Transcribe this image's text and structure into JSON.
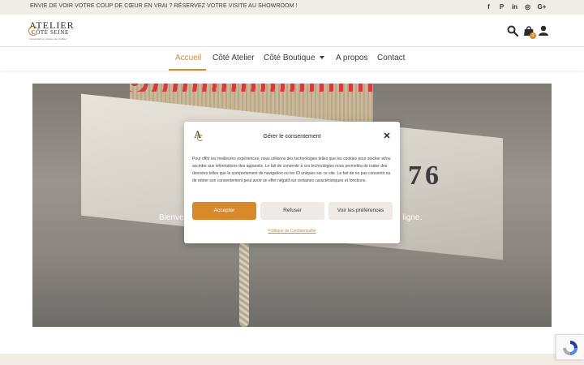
{
  "topbar": {
    "message": "ENVIE DE VOIR VOTRE COUP DE CŒUR EN VRAI ? RÉSERVEZ VOTRE VISITE AU SHOWROOM !",
    "socials": [
      "facebook-icon",
      "pinterest-icon",
      "linkedin-icon",
      "instagram-icon",
      "google-plus-icon"
    ],
    "social_glyphs": [
      "f",
      "P",
      "in",
      "◎",
      "G+"
    ]
  },
  "header": {
    "logo": {
      "line1": "ATELIER",
      "line2": "CÔTÉ SEINE",
      "tagline": "restauration et création de mobilier"
    },
    "icons": [
      "search-icon",
      "shopping-bag-icon",
      "user-icon"
    ],
    "cart_count": "0"
  },
  "nav": {
    "items": [
      {
        "label": "Accueil",
        "active": true
      },
      {
        "label": "Côté Atelier",
        "active": false
      },
      {
        "label": "Côté Boutique",
        "active": false,
        "has_dropdown": true
      },
      {
        "label": "A propos",
        "active": false
      },
      {
        "label": "Contact",
        "active": false
      }
    ]
  },
  "hero": {
    "digits": "76",
    "text_left": "Bienve",
    "text_right": "n ligne."
  },
  "consent": {
    "title": "Gérer le consentement",
    "body": "Pour offrir les meilleures expériences, nous utilisons des technologies telles que les cookies pour stocker et/ou accéder aux informations des appareils. Le fait de consentir à ces technologies nous permettra de traiter des données telles que le comportement de navigation ou les ID uniques sur ce site. Le fait de ne pas consentir ou de retirer son consentement peut avoir un effet négatif sur certaines caractéristiques et fonctions.",
    "accept_label": "Accepter",
    "refuse_label": "Refuser",
    "prefs_label": "Voir les préférences",
    "policy_link": "Politique de Confidentialité"
  },
  "colors": {
    "accent": "#d9882a",
    "topbar_bg": "#f1ece4",
    "text": "#3a3a3a"
  }
}
